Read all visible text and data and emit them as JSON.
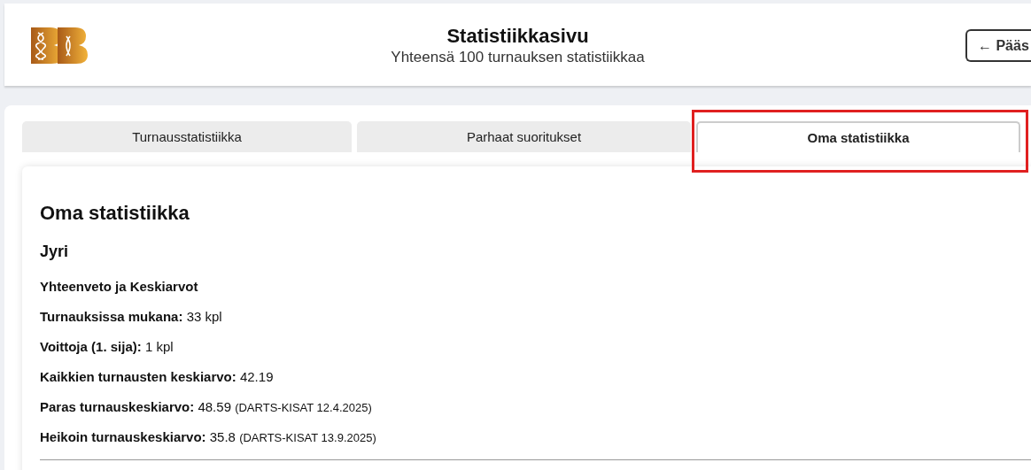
{
  "header": {
    "title": "Statistiikkasivu",
    "subtitle": "Yhteensä 100 turnauksen statistiikkaa",
    "back_button": "← Pääs"
  },
  "tabs": [
    {
      "label": "Turnausstatistiikka",
      "selected": false,
      "highlighted": false
    },
    {
      "label": "Parhaat suoritukset",
      "selected": false,
      "highlighted": false
    },
    {
      "label": "Oma statistiikka",
      "selected": true,
      "highlighted": true
    }
  ],
  "content": {
    "heading": "Oma statistiikka",
    "player": "Jyri",
    "section": "Yhteenveto ja Keskiarvot",
    "stats": [
      {
        "label": "Turnauksissa mukana:",
        "value": "33 kpl"
      },
      {
        "label": "Voittoja (1. sija):",
        "value": "1 kpl"
      },
      {
        "label": "Kaikkien turnausten keskiarvo:",
        "value": "42.19"
      },
      {
        "label": "Paras turnauskeskiarvo:",
        "value": "48.59",
        "note": "(DARTS-KISAT 12.4.2025)"
      },
      {
        "label": "Heikoin turnauskeskiarvo:",
        "value": "35.8",
        "note": "(DARTS-KISAT 13.9.2025)"
      }
    ]
  }
}
